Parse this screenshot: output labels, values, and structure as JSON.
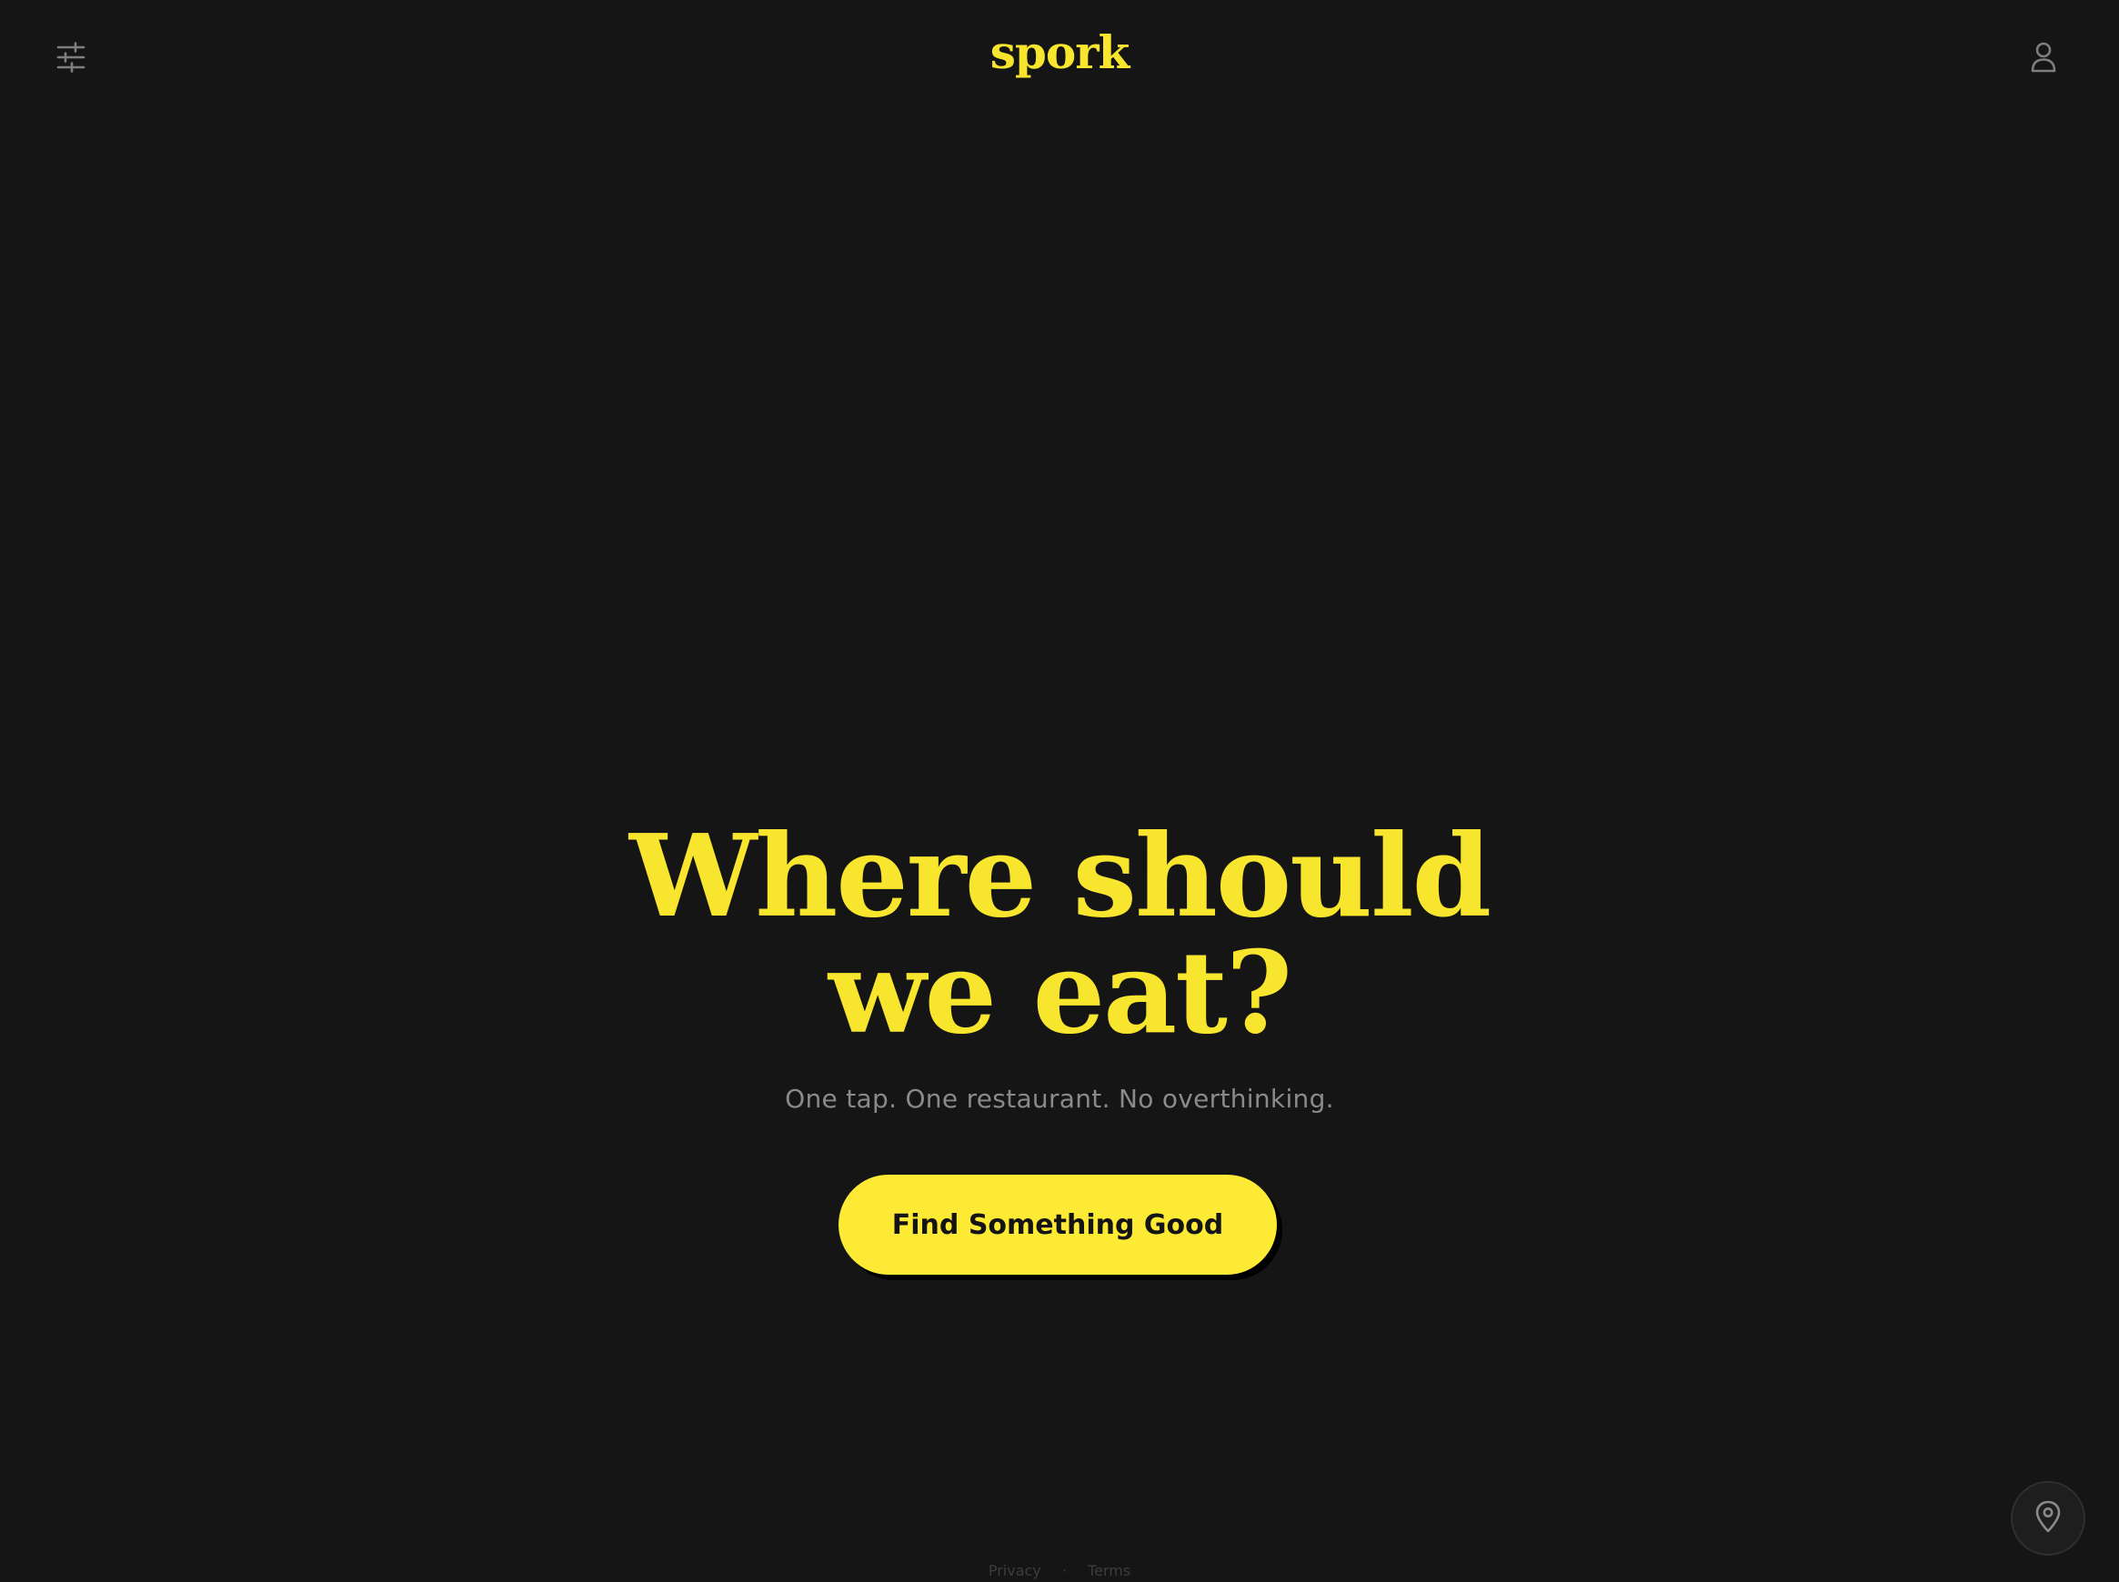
{
  "brand": {
    "logo": "spork",
    "accent_color": "#f8e62e",
    "background_color": "#151515"
  },
  "header": {
    "filter_icon": "sliders-icon",
    "account_icon": "user-icon"
  },
  "hero": {
    "headline_line1": "Where should",
    "headline_line2": "we eat?",
    "subtitle": "One tap. One restaurant. No overthinking."
  },
  "cta": {
    "label": "Find Something Good"
  },
  "location": {
    "icon": "map-pin-icon"
  },
  "footer": {
    "privacy": "Privacy",
    "separator": "·",
    "terms": "Terms"
  }
}
